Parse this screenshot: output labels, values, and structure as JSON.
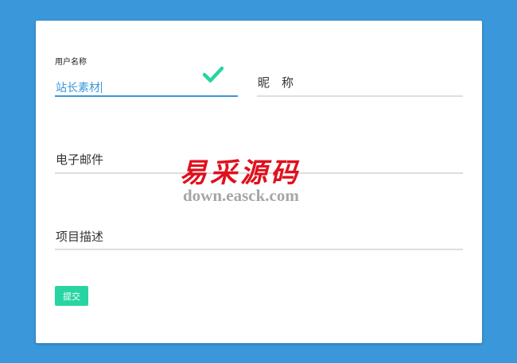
{
  "colors": {
    "background": "#3a97da",
    "card": "#ffffff",
    "accent": "#3a97da",
    "valid": "#27d5a2",
    "underline": "#dedede",
    "watermark_red": "#e0101c",
    "watermark_gray": "#a6a6a6"
  },
  "form": {
    "username": {
      "label": "用户名称",
      "value": "站长素材",
      "status_icon": "check-icon"
    },
    "nickname": {
      "placeholder": "昵　称"
    },
    "email": {
      "placeholder": "电子邮件"
    },
    "description": {
      "placeholder": "项目描述"
    },
    "submit_label": "提交"
  },
  "watermark": {
    "title": "易采源码",
    "url": "down.easck.com"
  }
}
